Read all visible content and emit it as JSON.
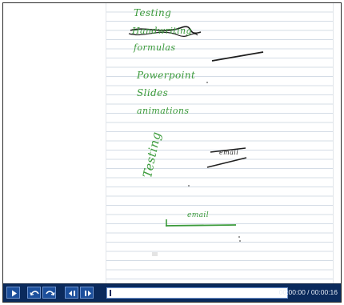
{
  "notebook": {
    "lines": {
      "testing_top": "Testing",
      "scribbled": "Handwriting",
      "third": "formulas",
      "powerpoint": "Powerpoint",
      "slides": "Slides",
      "animations": "animations",
      "vertical_testing": "Testing",
      "email_boxed": "email",
      "email_bottom": "email"
    },
    "ink_color": "#3a9a3a",
    "stroke_color": "#1f1f1f"
  },
  "player": {
    "time_display": "00:00:00 / 00:00:16",
    "progress_fraction": 0.0,
    "icons": {
      "play": "play-icon",
      "undo": "undo-icon",
      "redo": "redo-icon",
      "prev": "previous-icon",
      "next": "next-icon"
    }
  }
}
